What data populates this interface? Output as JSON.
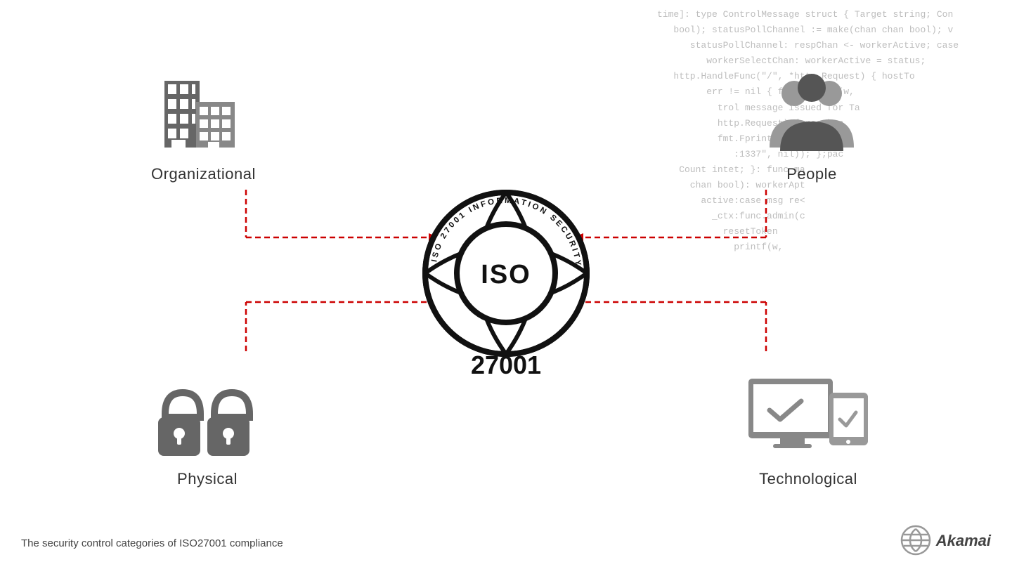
{
  "background": {
    "code_lines": [
      "time]: type ControlMessage struct { Target string; Con",
      "   bool); statusPollChannel := make(chan chan bool); v",
      "      statusPollChannel: respChan <- workerActive; case",
      "    workerSelectChan: workerActive = status;",
      "  http.HandleFunc(\"/\", *http.Request) { hostTo",
      "        err != nil { fmt.Fprintf(w,",
      "          trol message issued for Ta",
      "         http.Request) { reqChan",
      "         fmt.Fprint(w, \"ACTIVE\"",
      "            :1337\", nil)); };pac",
      "   Count intet; }: func ma",
      "     chan bool): workerApt",
      "      active:case msg re<",
      "        _ctx:func.admin(c",
      "          resetToken",
      "            printf(w,",
      "              ",
      "               ",
      "                "
    ]
  },
  "corners": {
    "organizational": {
      "label": "Organizational"
    },
    "people": {
      "label": "People"
    },
    "physical": {
      "label": "Physical"
    },
    "technological": {
      "label": "Technological"
    }
  },
  "center": {
    "ring_text": "ISO 27001 INFORMATION SECURITY",
    "number": "27001",
    "inner_text": "ISO"
  },
  "arrows": {
    "color": "#cc0000"
  },
  "footer": {
    "caption": "The security control categories of ISO27001 compliance",
    "brand": "Akamai"
  }
}
